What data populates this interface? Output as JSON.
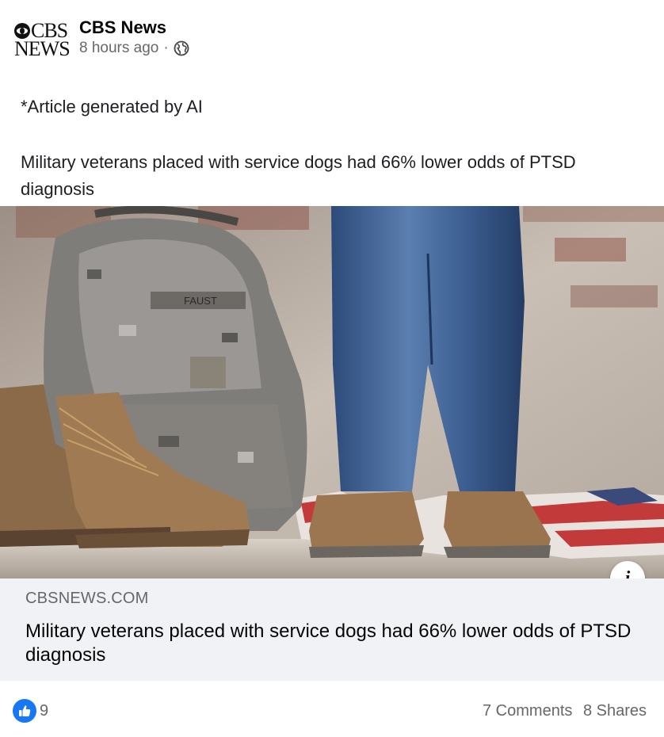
{
  "post": {
    "page_name": "CBS News",
    "time": "8 hours ago",
    "separator": "·",
    "privacy_icon": "globe-icon",
    "logo_text": {
      "line1": "CBS",
      "line2": "NEWS"
    },
    "text_line1": "*Article generated by AI",
    "text_line2": "Military veterans placed with service dogs had 66% lower odds of PTSD diagnosis"
  },
  "image": {
    "description_icon": "info-icon",
    "bag_tag": "FAUST"
  },
  "link_card": {
    "domain": "CBSNEWS.COM",
    "title": "Military veterans placed with service dogs had 66% lower odds of PTSD diagnosis"
  },
  "engagement": {
    "reaction_icon": "thumbs-up-icon",
    "reaction_count": "9",
    "comments": "7 Comments",
    "shares": "8 Shares"
  },
  "colors": {
    "accent": "#1877f2",
    "secondary_text": "#65676b",
    "card_bg": "#f0f2f5"
  }
}
